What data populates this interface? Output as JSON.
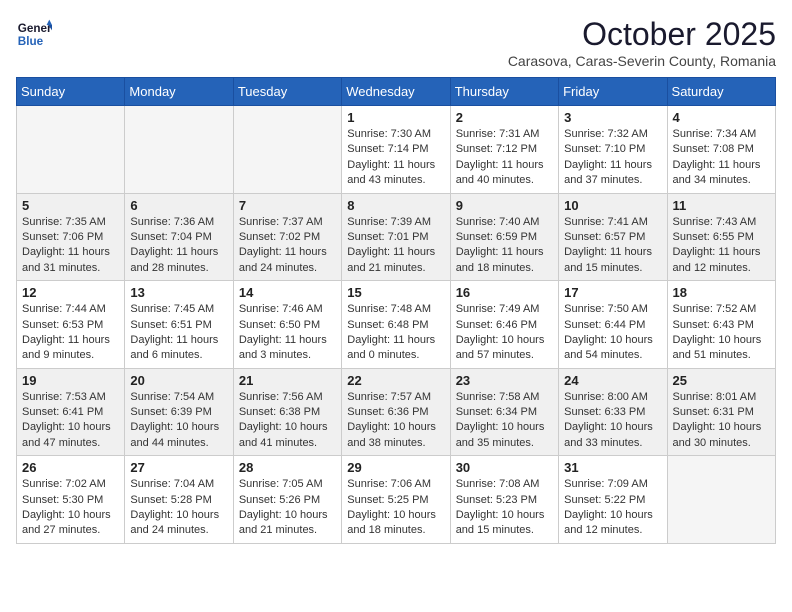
{
  "logo": {
    "line1": "General",
    "line2": "Blue"
  },
  "title": "October 2025",
  "subtitle": "Carasova, Caras-Severin County, Romania",
  "weekdays": [
    "Sunday",
    "Monday",
    "Tuesday",
    "Wednesday",
    "Thursday",
    "Friday",
    "Saturday"
  ],
  "weeks": [
    [
      {
        "day": "",
        "info": ""
      },
      {
        "day": "",
        "info": ""
      },
      {
        "day": "",
        "info": ""
      },
      {
        "day": "1",
        "info": "Sunrise: 7:30 AM\nSunset: 7:14 PM\nDaylight: 11 hours\nand 43 minutes."
      },
      {
        "day": "2",
        "info": "Sunrise: 7:31 AM\nSunset: 7:12 PM\nDaylight: 11 hours\nand 40 minutes."
      },
      {
        "day": "3",
        "info": "Sunrise: 7:32 AM\nSunset: 7:10 PM\nDaylight: 11 hours\nand 37 minutes."
      },
      {
        "day": "4",
        "info": "Sunrise: 7:34 AM\nSunset: 7:08 PM\nDaylight: 11 hours\nand 34 minutes."
      }
    ],
    [
      {
        "day": "5",
        "info": "Sunrise: 7:35 AM\nSunset: 7:06 PM\nDaylight: 11 hours\nand 31 minutes."
      },
      {
        "day": "6",
        "info": "Sunrise: 7:36 AM\nSunset: 7:04 PM\nDaylight: 11 hours\nand 28 minutes."
      },
      {
        "day": "7",
        "info": "Sunrise: 7:37 AM\nSunset: 7:02 PM\nDaylight: 11 hours\nand 24 minutes."
      },
      {
        "day": "8",
        "info": "Sunrise: 7:39 AM\nSunset: 7:01 PM\nDaylight: 11 hours\nand 21 minutes."
      },
      {
        "day": "9",
        "info": "Sunrise: 7:40 AM\nSunset: 6:59 PM\nDaylight: 11 hours\nand 18 minutes."
      },
      {
        "day": "10",
        "info": "Sunrise: 7:41 AM\nSunset: 6:57 PM\nDaylight: 11 hours\nand 15 minutes."
      },
      {
        "day": "11",
        "info": "Sunrise: 7:43 AM\nSunset: 6:55 PM\nDaylight: 11 hours\nand 12 minutes."
      }
    ],
    [
      {
        "day": "12",
        "info": "Sunrise: 7:44 AM\nSunset: 6:53 PM\nDaylight: 11 hours\nand 9 minutes."
      },
      {
        "day": "13",
        "info": "Sunrise: 7:45 AM\nSunset: 6:51 PM\nDaylight: 11 hours\nand 6 minutes."
      },
      {
        "day": "14",
        "info": "Sunrise: 7:46 AM\nSunset: 6:50 PM\nDaylight: 11 hours\nand 3 minutes."
      },
      {
        "day": "15",
        "info": "Sunrise: 7:48 AM\nSunset: 6:48 PM\nDaylight: 11 hours\nand 0 minutes."
      },
      {
        "day": "16",
        "info": "Sunrise: 7:49 AM\nSunset: 6:46 PM\nDaylight: 10 hours\nand 57 minutes."
      },
      {
        "day": "17",
        "info": "Sunrise: 7:50 AM\nSunset: 6:44 PM\nDaylight: 10 hours\nand 54 minutes."
      },
      {
        "day": "18",
        "info": "Sunrise: 7:52 AM\nSunset: 6:43 PM\nDaylight: 10 hours\nand 51 minutes."
      }
    ],
    [
      {
        "day": "19",
        "info": "Sunrise: 7:53 AM\nSunset: 6:41 PM\nDaylight: 10 hours\nand 47 minutes."
      },
      {
        "day": "20",
        "info": "Sunrise: 7:54 AM\nSunset: 6:39 PM\nDaylight: 10 hours\nand 44 minutes."
      },
      {
        "day": "21",
        "info": "Sunrise: 7:56 AM\nSunset: 6:38 PM\nDaylight: 10 hours\nand 41 minutes."
      },
      {
        "day": "22",
        "info": "Sunrise: 7:57 AM\nSunset: 6:36 PM\nDaylight: 10 hours\nand 38 minutes."
      },
      {
        "day": "23",
        "info": "Sunrise: 7:58 AM\nSunset: 6:34 PM\nDaylight: 10 hours\nand 35 minutes."
      },
      {
        "day": "24",
        "info": "Sunrise: 8:00 AM\nSunset: 6:33 PM\nDaylight: 10 hours\nand 33 minutes."
      },
      {
        "day": "25",
        "info": "Sunrise: 8:01 AM\nSunset: 6:31 PM\nDaylight: 10 hours\nand 30 minutes."
      }
    ],
    [
      {
        "day": "26",
        "info": "Sunrise: 7:02 AM\nSunset: 5:30 PM\nDaylight: 10 hours\nand 27 minutes."
      },
      {
        "day": "27",
        "info": "Sunrise: 7:04 AM\nSunset: 5:28 PM\nDaylight: 10 hours\nand 24 minutes."
      },
      {
        "day": "28",
        "info": "Sunrise: 7:05 AM\nSunset: 5:26 PM\nDaylight: 10 hours\nand 21 minutes."
      },
      {
        "day": "29",
        "info": "Sunrise: 7:06 AM\nSunset: 5:25 PM\nDaylight: 10 hours\nand 18 minutes."
      },
      {
        "day": "30",
        "info": "Sunrise: 7:08 AM\nSunset: 5:23 PM\nDaylight: 10 hours\nand 15 minutes."
      },
      {
        "day": "31",
        "info": "Sunrise: 7:09 AM\nSunset: 5:22 PM\nDaylight: 10 hours\nand 12 minutes."
      },
      {
        "day": "",
        "info": ""
      }
    ]
  ]
}
